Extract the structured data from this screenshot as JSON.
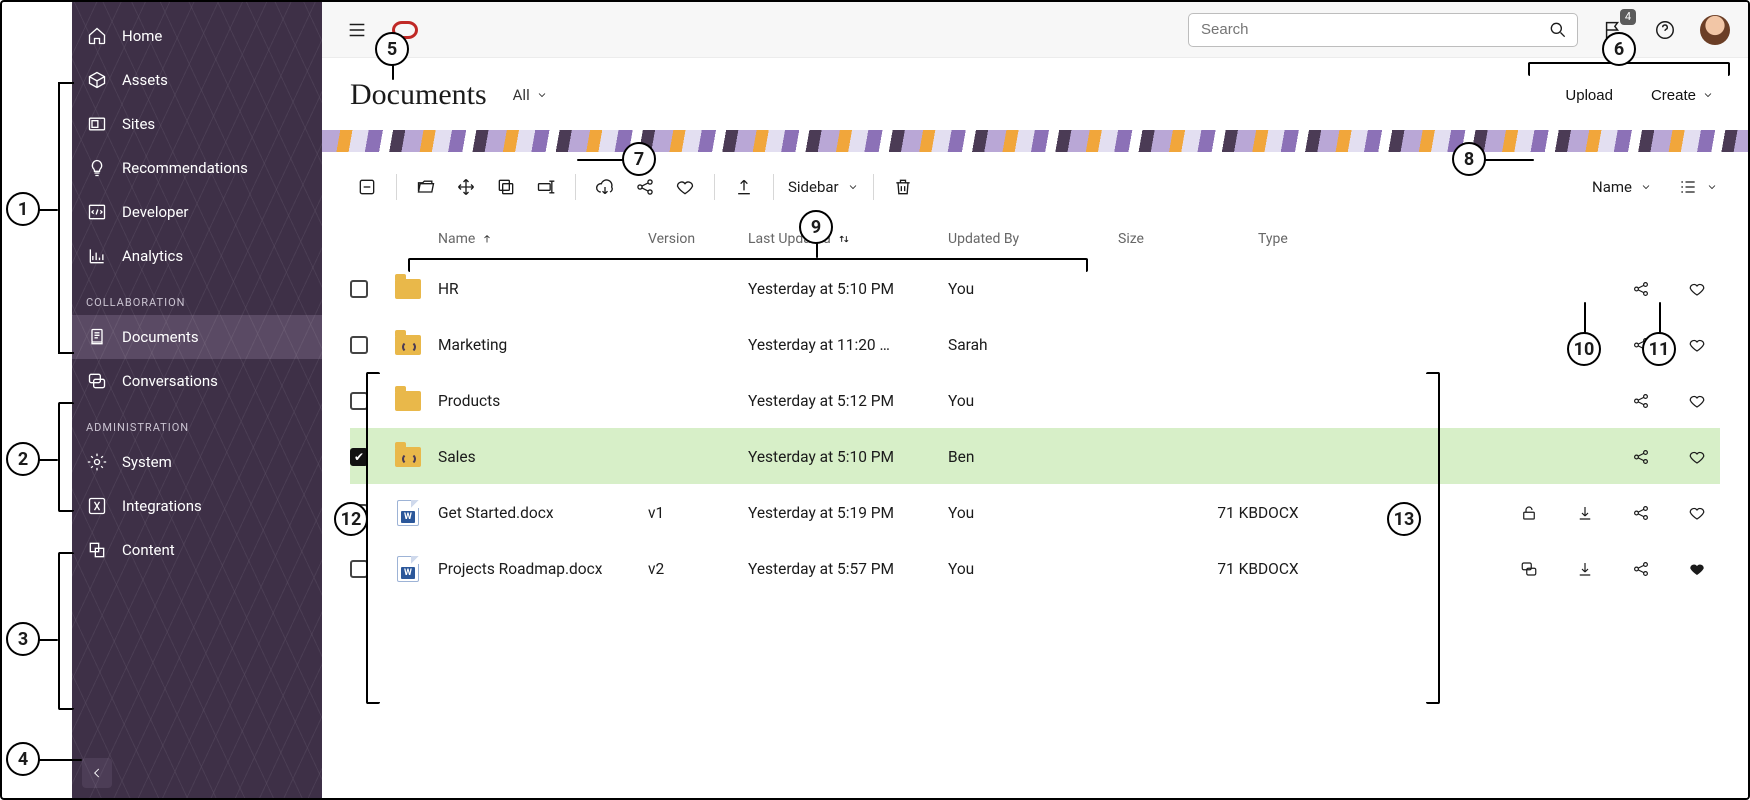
{
  "header": {
    "search_placeholder": "Search",
    "notif_count": "4"
  },
  "page": {
    "title": "Documents",
    "filter_label": "All",
    "upload_label": "Upload",
    "create_label": "Create"
  },
  "sidebar": {
    "nav": [
      {
        "label": "Home"
      },
      {
        "label": "Assets"
      },
      {
        "label": "Sites"
      },
      {
        "label": "Recommendations"
      },
      {
        "label": "Developer"
      },
      {
        "label": "Analytics"
      }
    ],
    "collab_heading": "COLLABORATION",
    "collab": [
      {
        "label": "Documents"
      },
      {
        "label": "Conversations"
      }
    ],
    "admin_heading": "ADMINISTRATION",
    "admin": [
      {
        "label": "System"
      },
      {
        "label": "Integrations"
      },
      {
        "label": "Content"
      }
    ]
  },
  "actionbar": {
    "sidebar_label": "Sidebar",
    "sort_label": "Name"
  },
  "columns": {
    "name": "Name",
    "version": "Version",
    "last_updated": "Last Updated",
    "updated_by": "Updated By",
    "size": "Size",
    "type": "Type"
  },
  "rows": [
    {
      "name": "HR",
      "kind": "folder",
      "shared": false,
      "version": "",
      "updated": "Yesterday at 5:10 PM",
      "by": "You",
      "size": "",
      "type": "",
      "checked": false,
      "trail": [
        "share",
        "heart"
      ]
    },
    {
      "name": "Marketing",
      "kind": "folder",
      "shared": true,
      "version": "",
      "updated": "Yesterday at 11:20 …",
      "by": "Sarah",
      "size": "",
      "type": "",
      "checked": false,
      "trail": [
        "chat",
        "share",
        "heart"
      ]
    },
    {
      "name": "Products",
      "kind": "folder",
      "shared": false,
      "version": "",
      "updated": "Yesterday at 5:12 PM",
      "by": "You",
      "size": "",
      "type": "",
      "checked": false,
      "trail": [
        "share",
        "heart"
      ]
    },
    {
      "name": "Sales",
      "kind": "folder",
      "shared": true,
      "version": "",
      "updated": "Yesterday at 5:10 PM",
      "by": "Ben",
      "size": "",
      "type": "",
      "checked": true,
      "trail": [
        "share",
        "heart"
      ]
    },
    {
      "name": "Get Started.docx",
      "kind": "doc",
      "shared": false,
      "version": "v1",
      "updated": "Yesterday at 5:19 PM",
      "by": "You",
      "size": "71 KB",
      "type": "DOCX",
      "checked": false,
      "trail": [
        "lock",
        "download",
        "share",
        "heart"
      ]
    },
    {
      "name": "Projects Roadmap.docx",
      "kind": "doc",
      "shared": false,
      "version": "v2",
      "updated": "Yesterday at 5:57 PM",
      "by": "You",
      "size": "71 KB",
      "type": "DOCX",
      "checked": false,
      "trail": [
        "chat",
        "download",
        "share",
        "heartfill"
      ]
    }
  ],
  "callouts": {
    "1": "1",
    "2": "2",
    "3": "3",
    "4": "4",
    "5": "5",
    "6": "6",
    "7": "7",
    "8": "8",
    "9": "9",
    "10": "10",
    "11": "11",
    "12": "12",
    "13": "13"
  }
}
